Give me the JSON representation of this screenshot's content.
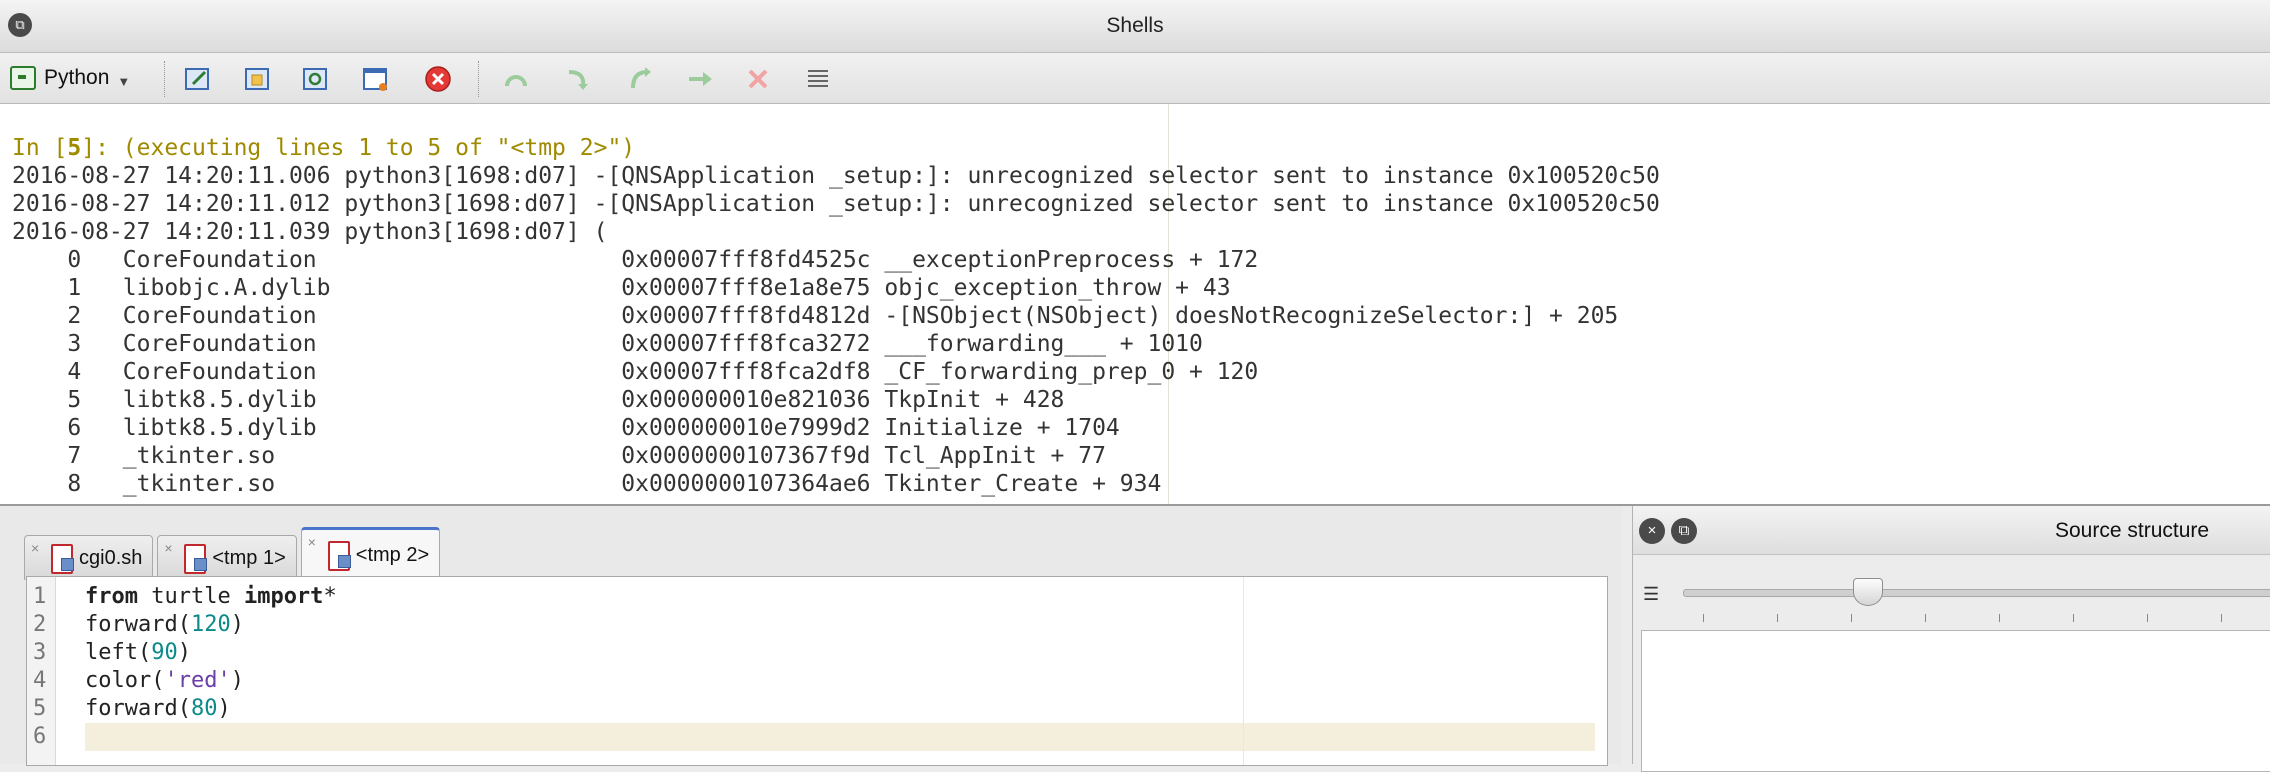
{
  "window": {
    "title": "Shells"
  },
  "toolbar": {
    "interpreter": "Python"
  },
  "console": {
    "prompt_num": "5",
    "prompt_rest": "(executing lines 1 to 5 of \"<tmp 2>\")",
    "lines": [
      "2016-08-27 14:20:11.006 python3[1698:d07] -[QNSApplication _setup:]: unrecognized selector sent to instance 0x100520c50",
      "2016-08-27 14:20:11.012 python3[1698:d07] -[QNSApplication _setup:]: unrecognized selector sent to instance 0x100520c50",
      "2016-08-27 14:20:11.039 python3[1698:d07] (",
      "    0   CoreFoundation                      0x00007fff8fd4525c __exceptionPreprocess + 172",
      "    1   libobjc.A.dylib                     0x00007fff8e1a8e75 objc_exception_throw + 43",
      "    2   CoreFoundation                      0x00007fff8fd4812d -[NSObject(NSObject) doesNotRecognizeSelector:] + 205",
      "    3   CoreFoundation                      0x00007fff8fca3272 ___forwarding___ + 1010",
      "    4   CoreFoundation                      0x00007fff8fca2df8 _CF_forwarding_prep_0 + 120",
      "    5   libtk8.5.dylib                      0x000000010e821036 TkpInit + 428",
      "    6   libtk8.5.dylib                      0x000000010e7999d2 Initialize + 1704",
      "    7   _tkinter.so                         0x0000000107367f9d Tcl_AppInit + 77",
      "    8   _tkinter.so                         0x0000000107364ae6 Tkinter_Create + 934"
    ]
  },
  "tabs": [
    {
      "label": "cgi0.sh"
    },
    {
      "label": "<tmp 1>"
    },
    {
      "label": "<tmp 2>"
    }
  ],
  "editor": {
    "line_numbers": [
      "1",
      "2",
      "3",
      "4",
      "5",
      "6"
    ],
    "code": {
      "l1_kw1": "from",
      "l1_mod": " turtle ",
      "l1_kw2": "import",
      "l1_star": "*",
      "l2_fn": "forward(",
      "l2_num": "120",
      "l2_end": ")",
      "l3_fn": "left(",
      "l3_num": "90",
      "l3_end": ")",
      "l4_fn": "color(",
      "l4_str": "'red'",
      "l4_end": ")",
      "l5_fn": "forward(",
      "l5_num": "80",
      "l5_end": ")"
    }
  },
  "source_structure": {
    "title": "Source structure"
  }
}
